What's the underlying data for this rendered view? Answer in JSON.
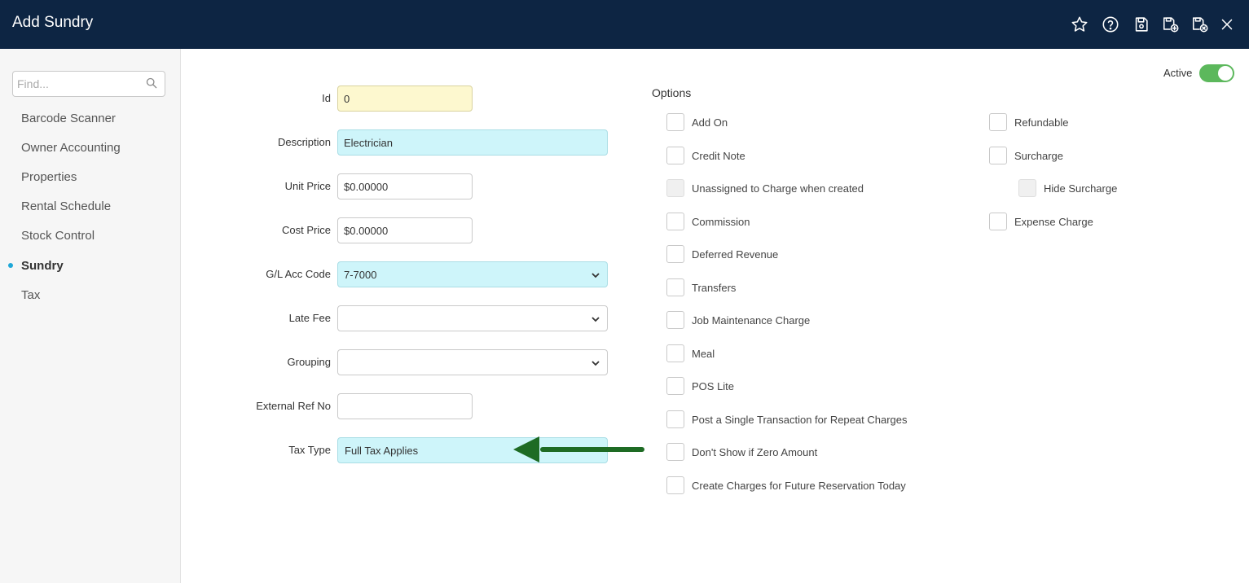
{
  "window": {
    "title": "Add Sundry"
  },
  "toolbar": {
    "icons": [
      "star-icon",
      "help-icon",
      "save-icon",
      "save-and-new-icon",
      "save-and-close-icon",
      "close-icon"
    ]
  },
  "sidebar": {
    "search_placeholder": "Find...",
    "items": [
      {
        "label": "Barcode Scanner"
      },
      {
        "label": "Owner Accounting"
      },
      {
        "label": "Properties"
      },
      {
        "label": "Rental Schedule"
      },
      {
        "label": "Stock Control"
      },
      {
        "label": "Sundry",
        "active": true
      },
      {
        "label": "Tax"
      }
    ]
  },
  "status": {
    "active_label": "Active",
    "active_on": true,
    "toggle_color": "#5cb85c"
  },
  "form": {
    "id": {
      "label": "Id",
      "value": "0"
    },
    "description": {
      "label": "Description",
      "value": "Electrician"
    },
    "unit_price": {
      "label": "Unit Price",
      "value": "$0.00000"
    },
    "cost_price": {
      "label": "Cost Price",
      "value": "$0.00000"
    },
    "gl_acc_code": {
      "label": "G/L Acc Code",
      "value": "7-7000"
    },
    "late_fee": {
      "label": "Late Fee",
      "value": ""
    },
    "grouping": {
      "label": "Grouping",
      "value": ""
    },
    "external_ref": {
      "label": "External Ref No",
      "value": ""
    },
    "tax_type": {
      "label": "Tax Type",
      "value": "Full Tax Applies"
    }
  },
  "options": {
    "title": "Options",
    "left": [
      {
        "label": "Add On"
      },
      {
        "label": "Credit Note"
      },
      {
        "label": "Unassigned to Charge when created",
        "disabled": true
      },
      {
        "label": "Commission"
      },
      {
        "label": "Deferred Revenue"
      },
      {
        "label": "Transfers"
      },
      {
        "label": "Job Maintenance Charge"
      },
      {
        "label": "Meal"
      },
      {
        "label": "POS Lite"
      },
      {
        "label": "Post a Single Transaction for Repeat Charges"
      },
      {
        "label": "Don't Show if Zero Amount"
      },
      {
        "label": "Create Charges for Future Reservation Today"
      }
    ],
    "right": [
      {
        "label": "Refundable"
      },
      {
        "label": "Surcharge"
      },
      {
        "label": "Hide Surcharge",
        "disabled": true
      },
      {
        "label": "Expense Charge"
      }
    ]
  },
  "colors": {
    "header_bg": "#0d2543",
    "id_field_bg": "#fdf8cf",
    "required_field_bg": "#cef5fa",
    "nav_active_dot": "#1fa8d8",
    "annotation_arrow": "#1e6b24"
  }
}
